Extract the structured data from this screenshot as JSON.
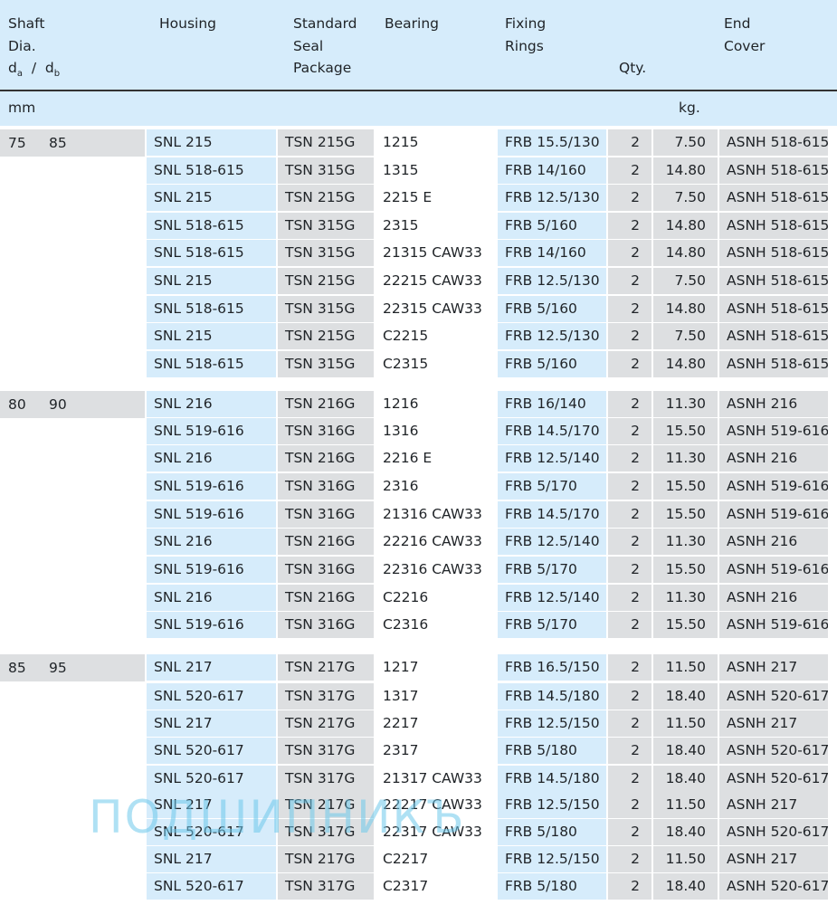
{
  "header": {
    "shaft": "Shaft\nDia.\ndₐ  /  d_b",
    "housing": "Housing",
    "seal": "Standard\nSeal\nPackage",
    "bearing": "Bearing",
    "fixing": "Fixing\nRings",
    "qty": "Qty.",
    "end": "End\nCover"
  },
  "units": {
    "mm": "mm",
    "kg": "kg."
  },
  "groups": [
    {
      "da": "75",
      "db": "85",
      "rows": [
        [
          "SNL 215",
          "TSN 215G",
          "1215",
          "FRB 15.5/130",
          "2",
          "7.50",
          "ASNH 518-615"
        ],
        [
          "SNL 518-615",
          "TSN 315G",
          "1315",
          "FRB 14/160",
          "2",
          "14.80",
          "ASNH 518-615"
        ],
        [
          "SNL 215",
          "TSN 215G",
          "2215 E",
          "FRB 12.5/130",
          "2",
          "7.50",
          "ASNH 518-615"
        ],
        [
          "SNL 518-615",
          "TSN 315G",
          "2315",
          "FRB 5/160",
          "2",
          "14.80",
          "ASNH 518-615"
        ],
        [
          "SNL 518-615",
          "TSN 315G",
          "21315 CAW33",
          "FRB 14/160",
          "2",
          "14.80",
          "ASNH 518-615"
        ],
        [
          "SNL 215",
          "TSN 215G",
          "22215 CAW33",
          "FRB 12.5/130",
          "2",
          "7.50",
          "ASNH 518-615"
        ],
        [
          "SNL 518-615",
          "TSN 315G",
          "22315 CAW33",
          "FRB 5/160",
          "2",
          "14.80",
          "ASNH 518-615"
        ],
        [
          "SNL 215",
          "TSN 215G",
          "C2215",
          "FRB 12.5/130",
          "2",
          "7.50",
          "ASNH 518-615"
        ],
        [
          "SNL 518-615",
          "TSN 315G",
          "C2315",
          "FRB 5/160",
          "2",
          "14.80",
          "ASNH 518-615"
        ]
      ]
    },
    {
      "da": "80",
      "db": "90",
      "rows": [
        [
          "SNL 216",
          "TSN 216G",
          "1216",
          "FRB 16/140",
          "2",
          "11.30",
          "ASNH 216"
        ],
        [
          "SNL 519-616",
          "TSN 316G",
          "1316",
          "FRB 14.5/170",
          "2",
          "15.50",
          "ASNH 519-616"
        ],
        [
          "SNL 216",
          "TSN 216G",
          "2216 E",
          "FRB 12.5/140",
          "2",
          "11.30",
          "ASNH 216"
        ],
        [
          "SNL 519-616",
          "TSN 316G",
          "2316",
          "FRB 5/170",
          "2",
          "15.50",
          "ASNH 519-616"
        ],
        [
          "SNL 519-616",
          "TSN 316G",
          "21316 CAW33",
          "FRB 14.5/170",
          "2",
          "15.50",
          "ASNH 519-616"
        ],
        [
          "SNL 216",
          "TSN 216G",
          "22216 CAW33",
          "FRB 12.5/140",
          "2",
          "11.30",
          "ASNH 216"
        ],
        [
          "SNL 519-616",
          "TSN 316G",
          "22316 CAW33",
          "FRB 5/170",
          "2",
          "15.50",
          "ASNH 519-616"
        ],
        [
          "SNL 216",
          "TSN 216G",
          "C2216",
          "FRB 12.5/140",
          "2",
          "11.30",
          "ASNH 216"
        ],
        [
          "SNL 519-616",
          "TSN 316G",
          "C2316",
          "FRB 5/170",
          "2",
          "15.50",
          "ASNH 519-616"
        ]
      ]
    },
    {
      "da": "85",
      "db": "95",
      "rows": [
        [
          "SNL 217",
          "TSN 217G",
          "1217",
          "FRB 16.5/150",
          "2",
          "11.50",
          "ASNH 217"
        ],
        [
          "SNL 520-617",
          "TSN 317G",
          "1317",
          "FRB 14.5/180",
          "2",
          "18.40",
          "ASNH 520-617"
        ],
        [
          "SNL 217",
          "TSN 217G",
          "2217",
          "FRB 12.5/150",
          "2",
          "11.50",
          "ASNH 217"
        ],
        [
          "SNL 520-617",
          "TSN 317G",
          "2317",
          "FRB 5/180",
          "2",
          "18.40",
          "ASNH 520-617"
        ],
        [
          "SNL 520-617",
          "TSN 317G",
          "21317 CAW33",
          "FRB 14.5/180",
          "2",
          "18.40",
          "ASNH 520-617"
        ],
        [
          "SNL 217",
          "TSN 217G",
          "22217 CAW33",
          "FRB 12.5/150",
          "2",
          "11.50",
          "ASNH 217"
        ],
        [
          "SNL 520-617",
          "TSN 317G",
          "22317 CAW33",
          "FRB 5/180",
          "2",
          "18.40",
          "ASNH 520-617"
        ],
        [
          "SNL 217",
          "TSN 217G",
          "C2217",
          "FRB 12.5/150",
          "2",
          "11.50",
          "ASNH 217"
        ],
        [
          "SNL 520-617",
          "TSN 317G",
          "C2317",
          "FRB 5/180",
          "2",
          "18.40",
          "ASNH 520-617"
        ]
      ]
    }
  ],
  "watermark": "ПОДШИПНИКЪ",
  "colors": {
    "blue": "#d6ecfb",
    "grey": "#dddfe1"
  }
}
